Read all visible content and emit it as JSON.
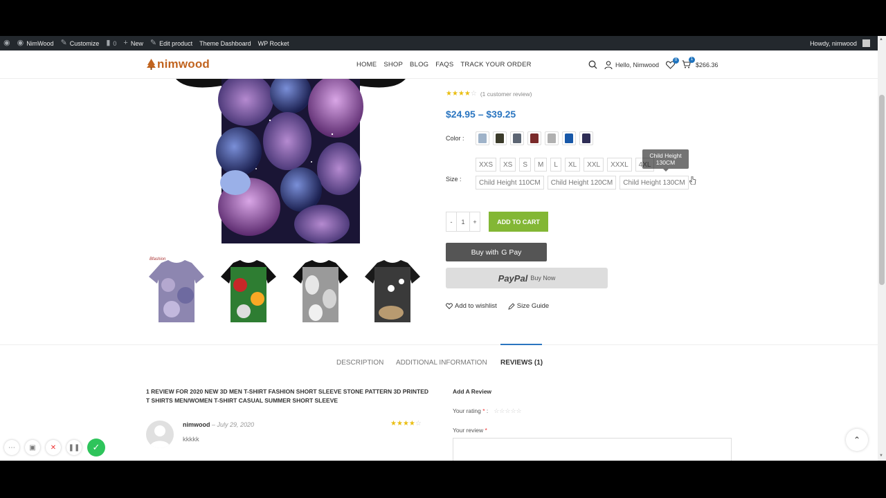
{
  "admin_bar": {
    "site_name": "NimWood",
    "customize": "Customize",
    "comments_count": "0",
    "new_label": "New",
    "edit_product": "Edit product",
    "theme_dashboard": "Theme Dashboard",
    "wp_rocket": "WP Rocket",
    "howdy": "Howdy, nimwood"
  },
  "header": {
    "logo_text": "nimwood",
    "nav": [
      "HOME",
      "SHOP",
      "BLOG",
      "FAQS",
      "TRACK YOUR ORDER"
    ],
    "account_label": "Hello, Nimwood",
    "wishlist_count": "0",
    "cart_count": "1",
    "cart_total": "$266.36"
  },
  "product": {
    "thumb_brand": "Bfashion",
    "rating_stars": 4,
    "review_link": "(1 customer review)",
    "price": "$24.95 – $39.25",
    "color_label": "Color :",
    "color_swatches": [
      "#9fb3c9",
      "#3b3b2a",
      "#5c6573",
      "#7a2a2a",
      "#b0b0b0",
      "#1858a8",
      "#2e2d55"
    ],
    "size_label": "Size :",
    "sizes_row1": [
      "XXS",
      "XS",
      "S",
      "M",
      "L",
      "XL",
      "XXL",
      "XXXL",
      "4XL"
    ],
    "sizes_row2": [
      "Child Height 110CM",
      "Child Height 120CM",
      "Child Height 130CM"
    ],
    "tooltip": "Child Height 130CM",
    "qty_minus": "-",
    "qty_value": "1",
    "qty_plus": "+",
    "add_to_cart": "ADD TO CART",
    "gpay_prefix": "Buy with",
    "gpay_brand": "G Pay",
    "paypal_brand": "PayPal",
    "paypal_action": "Buy Now",
    "wishlist_link": "Add to wishlist",
    "size_guide_link": "Size Guide"
  },
  "tabs": {
    "description": "DESCRIPTION",
    "additional": "ADDITIONAL INFORMATION",
    "reviews": "REVIEWS (1)"
  },
  "reviews": {
    "heading": "1 REVIEW FOR 2020 NEW 3D MEN T-SHIRT FASHION SHORT SLEEVE STONE PATTERN 3D PRINTED T SHIRTS MEN/WOMEN T-SHIRT CASUAL SUMMER SHORT SLEEVE",
    "author": "nimwood",
    "date": "– July 29, 2020",
    "stars": 4,
    "text": "kkkkk",
    "add_review": "Add A Review",
    "your_rating": "Your rating",
    "your_review": "Your review",
    "required": "*"
  },
  "colors": {
    "accent_blue": "#2a75c0",
    "add_cart_green": "#83b735",
    "admin_bar": "#23282d",
    "logo_orange": "#c1641f"
  }
}
